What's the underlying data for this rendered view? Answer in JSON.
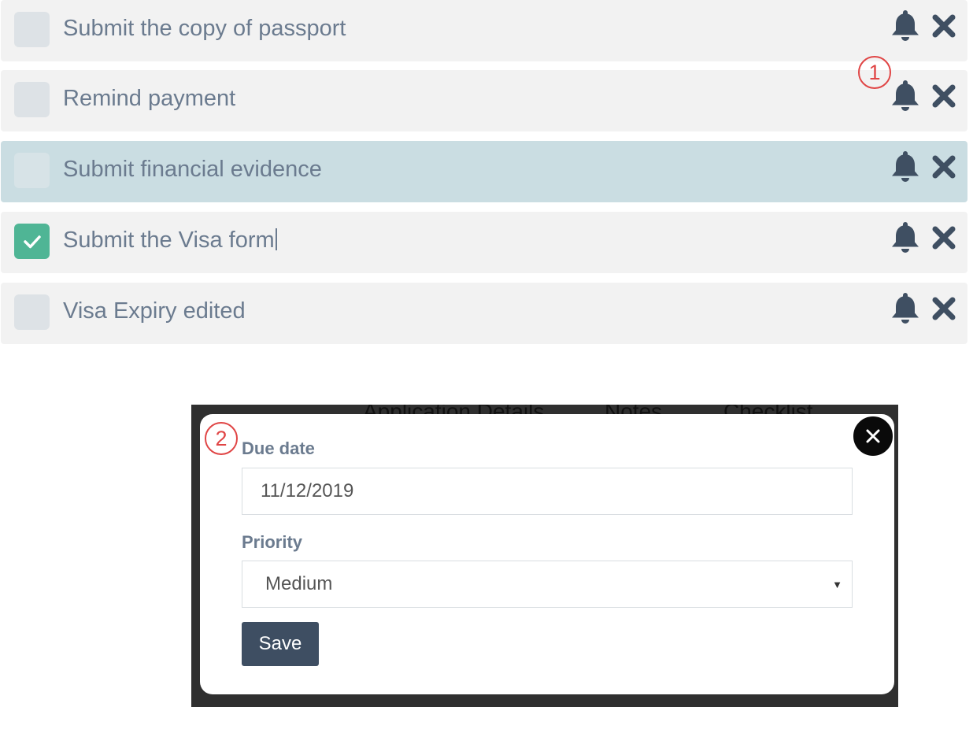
{
  "tasks": [
    {
      "label": "Submit the copy of passport",
      "checked": false,
      "highlighted": false
    },
    {
      "label": "Remind payment",
      "checked": false,
      "highlighted": false
    },
    {
      "label": "Submit financial evidence",
      "checked": false,
      "highlighted": true
    },
    {
      "label": "Submit the Visa form",
      "checked": true,
      "highlighted": false
    },
    {
      "label": "Visa Expiry edited",
      "checked": false,
      "highlighted": false
    }
  ],
  "icons": {
    "reminder": "bell-icon",
    "delete": "close-icon",
    "modal_close": "close-icon",
    "check": "checkmark-icon"
  },
  "markers": {
    "first": "1",
    "second": "2"
  },
  "background_tabs": [
    "Application Details",
    "Notes",
    "Checklist"
  ],
  "modal": {
    "due_date_label": "Due date",
    "due_date_value": "11/12/2019",
    "priority_label": "Priority",
    "priority_value": "Medium",
    "save_label": "Save"
  },
  "colors": {
    "row_background": "#f2f2f2",
    "row_highlight": "#cadde2",
    "check_active": "#4fb595",
    "icon_color": "#3f4f62",
    "marker_red": "#e04545",
    "save_button": "#3e4e62"
  }
}
